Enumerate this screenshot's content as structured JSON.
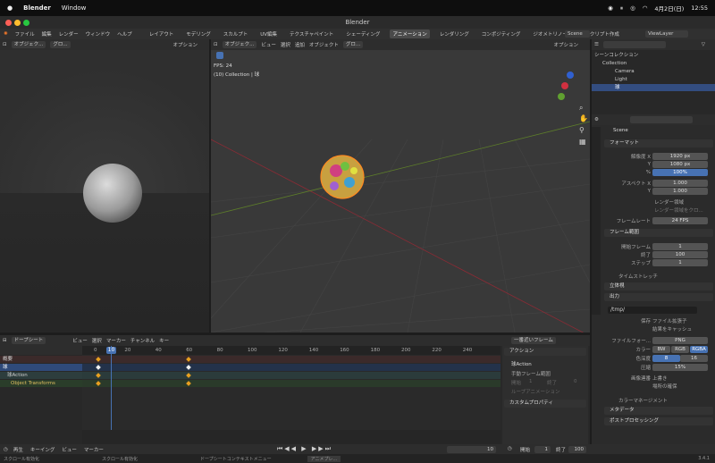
{
  "mac": {
    "app": "Blender",
    "menu": [
      "Window"
    ],
    "date": "4月2日(日)",
    "time": "12:55"
  },
  "window": {
    "title": "Blender"
  },
  "topbar": {
    "menus": [
      "ファイル",
      "編集",
      "レンダー",
      "ウィンドウ",
      "ヘルプ"
    ],
    "workspaces": [
      "レイアウト",
      "モデリング",
      "スカルプト",
      "UV編集",
      "テクスチャペイント",
      "シェーディング",
      "アニメーション",
      "レンダリング",
      "コンポジティング",
      "ジオメトリノード",
      "スクリプト作成"
    ],
    "active_workspace": "アニメーション",
    "scene": "Scene",
    "viewlayer": "ViewLayer"
  },
  "left_view": {
    "mode": "オブジェク...",
    "view": "グロ...",
    "options": "オプション"
  },
  "main_view": {
    "mode": "オブジェク...",
    "menus": [
      "ビュー",
      "選択",
      "追加",
      "オブジェクト"
    ],
    "shading": "グロ...",
    "options": "オプション",
    "fps": "FPS: 24",
    "info": "(10) Collection | 球"
  },
  "outliner": {
    "items": [
      {
        "label": "シーンコレクション"
      },
      {
        "label": "Collection"
      },
      {
        "label": "Camera"
      },
      {
        "label": "Light"
      },
      {
        "label": "球"
      }
    ]
  },
  "properties": {
    "search_placeholder": "",
    "scene": "Scene",
    "format": {
      "title": "フォーマット",
      "res_x_label": "解像度 X",
      "res_x": "1920 px",
      "res_y_label": "Y",
      "res_y": "1080 px",
      "pct_label": "%",
      "pct": "100%",
      "aspect_x_label": "アスペクト X",
      "aspect_x": "1.000",
      "aspect_y_label": "Y",
      "aspect_y": "1.000",
      "border": "レンダー領域",
      "crop": "レンダー領域をクロ...",
      "fps_label": "フレームレート",
      "fps": "24 FPS"
    },
    "frame_range": {
      "title": "フレーム範囲",
      "start_label": "開始フレーム",
      "start": "1",
      "end_label": "終了",
      "end": "100",
      "step_label": "ステップ",
      "step": "1"
    },
    "time_stretch": "タイムストレッチ",
    "stereo": "立体視",
    "output": {
      "title": "出力",
      "path": "/tmp/",
      "save_label": "保存",
      "file_ext": "ファイル拡張子",
      "cache": "結果をキャッシュ",
      "format_label": "ファイルフォー...",
      "format": "PNG",
      "color_label": "カラー",
      "color_opts": [
        "BW",
        "RGB",
        "RGBA"
      ],
      "depth_label": "色深度",
      "depth_opts": [
        "8",
        "16"
      ],
      "compress_label": "圧縮",
      "compress": "15%",
      "seq_label": "画像連番",
      "overwrite": "上書き",
      "placeholders": "場所の確保",
      "colormgmt": "カラーマネージメント"
    },
    "metadata": "メタデータ",
    "postproc": "ポストプロセッシング"
  },
  "dopesheet": {
    "mode": "ドープシート",
    "menus": [
      "ビュー",
      "選択",
      "マーカー",
      "チャンネル",
      "キー"
    ],
    "filter": "一番近いフレーム",
    "ticks": [
      "0",
      "10",
      "20",
      "40",
      "60",
      "80",
      "100",
      "120",
      "140",
      "160",
      "180",
      "200",
      "220",
      "240"
    ],
    "current": "10",
    "channels": [
      "概要",
      "球",
      "球Action",
      "Object Transforms"
    ],
    "action_panel": {
      "title": "アクション",
      "name": "球Action",
      "manual": "手動フレーム範囲",
      "start": "開始",
      "start_val": "1",
      "end": "終了",
      "end_val": "0",
      "cyclic": "ループアニメーション",
      "custom": "カスタムプロパティ"
    }
  },
  "bottombar": {
    "items": [
      "再生",
      "キーイング",
      "ビュー",
      "マーカー"
    ],
    "frame": "10",
    "start_label": "開始",
    "start": "1",
    "end_label": "終了",
    "end": "100"
  },
  "statusbar": {
    "items": [
      "スクロール有効化",
      "スクロール有効化",
      "ドープシートコンテキストメニュー",
      "アニメプレ..."
    ],
    "version": "3.4.1"
  }
}
